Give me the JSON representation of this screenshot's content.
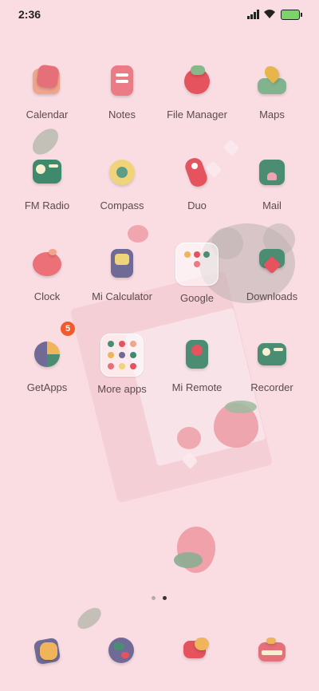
{
  "status_bar": {
    "time": "2:36"
  },
  "apps_row1": [
    {
      "label": "Calendar"
    },
    {
      "label": "Notes"
    },
    {
      "label": "File Manager"
    },
    {
      "label": "Maps"
    }
  ],
  "apps_row2": [
    {
      "label": "FM Radio"
    },
    {
      "label": "Compass"
    },
    {
      "label": "Duo"
    },
    {
      "label": "Mail"
    }
  ],
  "apps_row3": [
    {
      "label": "Clock"
    },
    {
      "label": "Mi Calculator"
    },
    {
      "label": "Google"
    },
    {
      "label": "Downloads"
    }
  ],
  "apps_row4": [
    {
      "label": "GetApps",
      "badge": "5"
    },
    {
      "label": "More apps"
    },
    {
      "label": "Mi Remote"
    },
    {
      "label": "Recorder"
    }
  ],
  "page_indicator": {
    "pages": 2,
    "current": 2
  },
  "dock": [
    {
      "icon": "gallery-icon"
    },
    {
      "icon": "browser-icon"
    },
    {
      "icon": "messages-icon"
    },
    {
      "icon": "camera-icon"
    }
  ],
  "colors": {
    "background": "#f9dde3",
    "badge": "#f2592b",
    "label": "#5b4b4f"
  }
}
